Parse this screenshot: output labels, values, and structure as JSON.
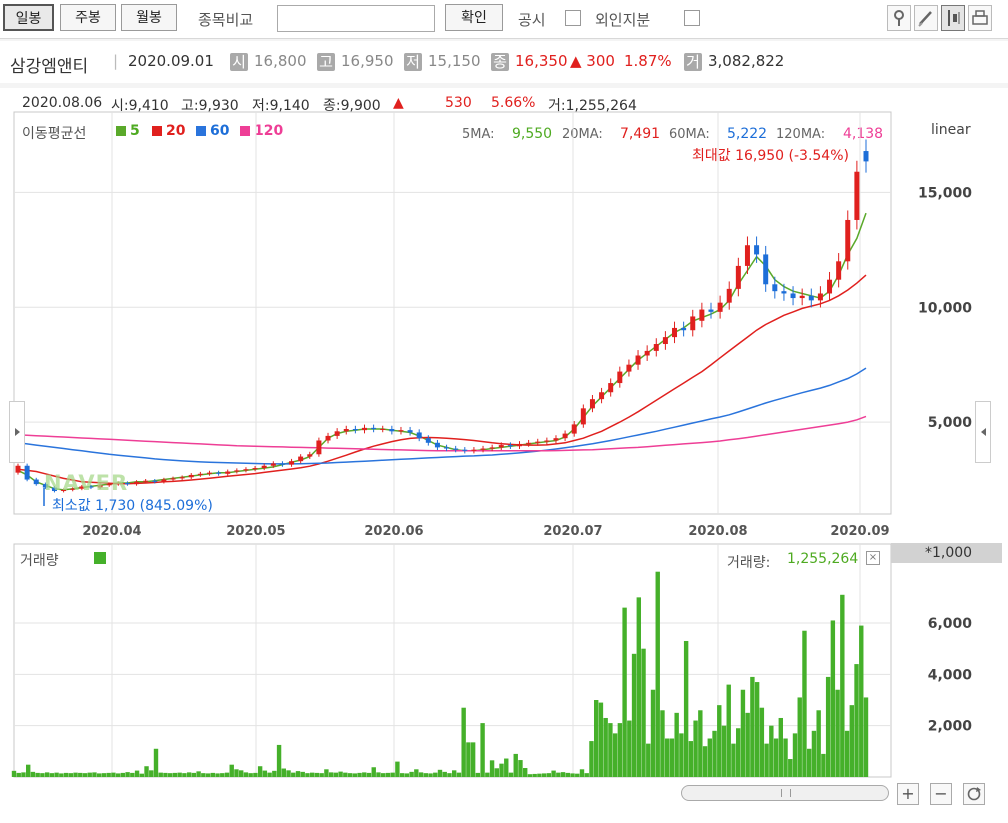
{
  "toolbar": {
    "daily": "일봉",
    "weekly": "주봉",
    "monthly": "월봉",
    "compare_label": "종목비교",
    "compare_value": "",
    "confirm": "확인",
    "disclosure": "공시",
    "foreign_ratio": "외인지분"
  },
  "stock": {
    "name": "삼강엠앤티",
    "date": "2020.09.01",
    "open_tag": "시",
    "open": "16,800",
    "high_tag": "고",
    "high": "16,950",
    "low_tag": "저",
    "low": "15,150",
    "close_tag": "종",
    "close": "16,350",
    "change": "▲ 300",
    "change_pct": "1.87%",
    "volume_tag": "거",
    "volume": "3,082,822"
  },
  "hover": {
    "date": "2020.08.06",
    "open": "시:9,410",
    "high": "고:9,930",
    "low": "저:9,140",
    "close": "종:9,900",
    "arrow": "▲",
    "change": "530",
    "change_pct": "5.66%",
    "volume": "거:1,255,264"
  },
  "ma_legend": {
    "title": "이동평균선",
    "p5": "5",
    "p20": "20",
    "p60": "60",
    "p120": "120",
    "ma5_label": "5MA:",
    "ma5": "9,550",
    "ma20_label": "20MA:",
    "ma20": "7,491",
    "ma60_label": "60MA:",
    "ma60": "5,222",
    "ma120_label": "120MA:",
    "ma120": "4,138"
  },
  "scale_label": "linear",
  "max_annot": "최대값 16,950 (-3.54%)",
  "min_annot": "최소값 1,730 (845.09%)",
  "watermark": "NAVER",
  "volume_panel": {
    "title": "거래량",
    "value_label": "거래량:",
    "value": "1,255,264",
    "unit": "*1,000"
  },
  "scroll": {
    "plus": "+",
    "minus": "−"
  },
  "colors": {
    "up": "#e0201e",
    "down": "#1d6ed8",
    "ma5": "#5aa92a",
    "ma20": "#e0201e",
    "ma60": "#2a74dc",
    "ma120": "#ee3e96",
    "volume": "#45b02a"
  },
  "chart_data": [
    {
      "type": "candlestick",
      "x_ticks": [
        "2020.04",
        "2020.05",
        "2020.06",
        "2020.07",
        "2020.08",
        "2020.09"
      ],
      "y_ticks": [
        "15,000",
        "10,000",
        "5,000"
      ],
      "y_values": [
        15000,
        10000,
        5000
      ],
      "ylim": [
        1000,
        18500
      ],
      "scale": "linear",
      "series": [
        {
          "name": "5",
          "values": [
            2900,
            2700,
            2400,
            2250,
            2100,
            2050,
            2100,
            2150,
            2200,
            2250,
            2300,
            2350,
            2350,
            2400,
            2400,
            2450,
            2500,
            2550,
            2600,
            2650,
            2700,
            2750,
            2800,
            2800,
            2850,
            2900,
            2950,
            3000,
            3050,
            3150,
            3250,
            3350,
            3500,
            3900,
            4300,
            4500,
            4600,
            4650,
            4700,
            4700,
            4700,
            4650,
            4600,
            4550,
            4400,
            4200,
            4000,
            3900,
            3800,
            3750,
            3750,
            3800,
            3850,
            3900,
            3950,
            4000,
            4050,
            4100,
            4150,
            4200,
            4350,
            4700,
            5200,
            5700,
            6100,
            6500,
            6900,
            7300,
            7700,
            8000,
            8300,
            8600,
            8900,
            9100,
            9400,
            9550,
            9700,
            9900,
            10300,
            11000,
            11600,
            12200,
            11800,
            11200,
            10900,
            10700,
            10600,
            10500,
            10400,
            10700,
            11400,
            12300,
            13000,
            14100
          ]
        },
        {
          "name": "20",
          "values": [
            2950,
            2900,
            2850,
            2750,
            2650,
            2550,
            2480,
            2400,
            2380,
            2360,
            2340,
            2320,
            2320,
            2330,
            2350,
            2370,
            2400,
            2420,
            2450,
            2480,
            2520,
            2560,
            2600,
            2640,
            2680,
            2720,
            2760,
            2810,
            2860,
            2910,
            2960,
            3010,
            3080,
            3180,
            3300,
            3430,
            3560,
            3700,
            3830,
            3950,
            4050,
            4150,
            4230,
            4290,
            4320,
            4330,
            4320,
            4300,
            4270,
            4240,
            4200,
            4150,
            4100,
            4060,
            4030,
            4010,
            4000,
            4000,
            4010,
            4050,
            4100,
            4200,
            4300,
            4450,
            4600,
            4800,
            5000,
            5220,
            5450,
            5700,
            5950,
            6200,
            6450,
            6700,
            6950,
            7200,
            7491,
            7800,
            8100,
            8400,
            8700,
            9000,
            9250,
            9450,
            9650,
            9800,
            9950,
            10050,
            10150,
            10300,
            10500,
            10750,
            11050,
            11400
          ]
        },
        {
          "name": "60",
          "values": [
            4100,
            4050,
            4000,
            3950,
            3900,
            3850,
            3800,
            3750,
            3700,
            3650,
            3600,
            3560,
            3520,
            3480,
            3440,
            3400,
            3370,
            3340,
            3310,
            3290,
            3270,
            3250,
            3240,
            3230,
            3220,
            3210,
            3200,
            3190,
            3180,
            3180,
            3180,
            3190,
            3200,
            3210,
            3220,
            3240,
            3260,
            3280,
            3300,
            3320,
            3340,
            3360,
            3380,
            3400,
            3420,
            3440,
            3460,
            3480,
            3500,
            3520,
            3530,
            3550,
            3570,
            3600,
            3630,
            3660,
            3700,
            3740,
            3780,
            3830,
            3880,
            3940,
            4000,
            4060,
            4130,
            4200,
            4280,
            4360,
            4440,
            4520,
            4600,
            4690,
            4780,
            4870,
            4960,
            5050,
            5140,
            5222,
            5320,
            5440,
            5570,
            5700,
            5830,
            5950,
            6060,
            6170,
            6280,
            6380,
            6480,
            6600,
            6750,
            6900,
            7100,
            7350
          ]
        },
        {
          "name": "120",
          "values": [
            4450,
            4430,
            4410,
            4390,
            4370,
            4350,
            4330,
            4310,
            4290,
            4270,
            4250,
            4230,
            4210,
            4190,
            4170,
            4150,
            4130,
            4110,
            4090,
            4070,
            4050,
            4030,
            4010,
            3990,
            3970,
            3960,
            3950,
            3940,
            3930,
            3920,
            3910,
            3900,
            3890,
            3880,
            3870,
            3860,
            3850,
            3840,
            3830,
            3820,
            3810,
            3800,
            3790,
            3780,
            3770,
            3760,
            3750,
            3750,
            3750,
            3750,
            3750,
            3750,
            3750,
            3750,
            3750,
            3750,
            3750,
            3750,
            3750,
            3760,
            3770,
            3780,
            3790,
            3800,
            3820,
            3840,
            3860,
            3880,
            3900,
            3930,
            3960,
            3990,
            4020,
            4050,
            4080,
            4110,
            4138,
            4180,
            4230,
            4280,
            4330,
            4390,
            4450,
            4510,
            4570,
            4630,
            4690,
            4750,
            4810,
            4870,
            4930,
            5000,
            5100,
            5250
          ]
        }
      ],
      "ohlc_close": [
        3100,
        2500,
        2300,
        2150,
        2000,
        2050,
        2100,
        2200,
        2150,
        2250,
        2300,
        2350,
        2300,
        2400,
        2450,
        2400,
        2500,
        2550,
        2600,
        2700,
        2750,
        2800,
        2750,
        2850,
        2900,
        2950,
        3000,
        3100,
        3200,
        3150,
        3300,
        3500,
        3600,
        4200,
        4400,
        4600,
        4700,
        4650,
        4750,
        4700,
        4700,
        4600,
        4650,
        4550,
        4300,
        4100,
        3900,
        3850,
        3800,
        3750,
        3800,
        3850,
        3900,
        4000,
        3950,
        4050,
        4100,
        4150,
        4200,
        4300,
        4500,
        4900,
        5600,
        6000,
        6300,
        6700,
        7200,
        7500,
        7900,
        8100,
        8400,
        8700,
        9100,
        9000,
        9600,
        9900,
        9800,
        10200,
        10800,
        11800,
        12700,
        12300,
        11000,
        10700,
        10600,
        10400,
        10500,
        10300,
        10600,
        11200,
        12000,
        13800,
        15900,
        16350
      ],
      "ohlc_open": [
        2800,
        3100,
        2500,
        2300,
        2150,
        2000,
        2050,
        2100,
        2200,
        2150,
        2250,
        2300,
        2350,
        2300,
        2400,
        2450,
        2400,
        2500,
        2550,
        2600,
        2700,
        2750,
        2800,
        2750,
        2850,
        2900,
        2950,
        3000,
        3100,
        3200,
        3150,
        3300,
        3500,
        3600,
        4200,
        4400,
        4600,
        4700,
        4650,
        4750,
        4700,
        4700,
        4600,
        4650,
        4550,
        4300,
        4100,
        3900,
        3850,
        3800,
        3750,
        3800,
        3850,
        3900,
        4000,
        3950,
        4050,
        4100,
        4150,
        4200,
        4300,
        4500,
        4900,
        5600,
        6000,
        6300,
        6700,
        7200,
        7500,
        7900,
        8100,
        8400,
        8700,
        9100,
        9000,
        9410,
        9900,
        9800,
        10200,
        10800,
        11800,
        12700,
        12300,
        11000,
        10700,
        10600,
        10400,
        10500,
        10300,
        10600,
        11200,
        12000,
        13800,
        16800
      ],
      "volume_ylim": [
        0,
        8300
      ],
      "volume_y_ticks": [
        "6,000",
        "4,000",
        "2,000"
      ],
      "volume_y_values": [
        6000,
        4000,
        2000
      ],
      "volume": [
        240,
        160,
        180,
        480,
        200,
        160,
        150,
        180,
        150,
        170,
        140,
        160,
        150,
        170,
        160,
        150,
        170,
        180,
        140,
        150,
        160,
        170,
        140,
        160,
        190,
        160,
        250,
        130,
        420,
        260,
        1100,
        170,
        160,
        150,
        160,
        170,
        150,
        180,
        160,
        220,
        150,
        140,
        160,
        140,
        150,
        170,
        480,
        300,
        260,
        180,
        150,
        160,
        420,
        250,
        170,
        240,
        1250,
        330,
        260,
        170,
        230,
        200,
        150,
        170,
        160,
        150,
        300,
        180,
        170,
        210,
        170,
        150,
        140,
        160,
        180,
        160,
        380,
        180,
        150,
        160,
        170,
        600,
        150,
        140,
        200,
        300,
        180,
        150,
        140,
        170,
        280,
        200,
        150,
        260,
        170,
        2700,
        1350,
        1350,
        160,
        2100,
        170,
        650,
        340,
        520,
        720,
        170,
        900,
        660,
        350,
        110,
        120,
        130,
        140,
        150,
        250,
        170,
        190,
        160,
        140,
        130,
        300,
        150,
        1400,
        3000,
        2900,
        2300,
        2100,
        1700,
        2100,
        6600,
        2200,
        4800,
        7000,
        5000,
        1300,
        3400,
        8000,
        2600,
        1500,
        1500,
        2500,
        1700,
        5300,
        1400,
        2200,
        2600,
        1200,
        1500,
        1800,
        2800,
        2000,
        3600,
        1300,
        1900,
        3400,
        2500,
        3900,
        3700,
        2700,
        1300,
        2000,
        1500,
        2300,
        1500,
        700,
        1700,
        3100,
        5700,
        1100,
        1800,
        2600,
        900,
        3900,
        6100,
        3400,
        7100,
        1800,
        2800,
        4400,
        5900,
        3100
      ],
      "x_label": "",
      "y_label": ""
    }
  ]
}
